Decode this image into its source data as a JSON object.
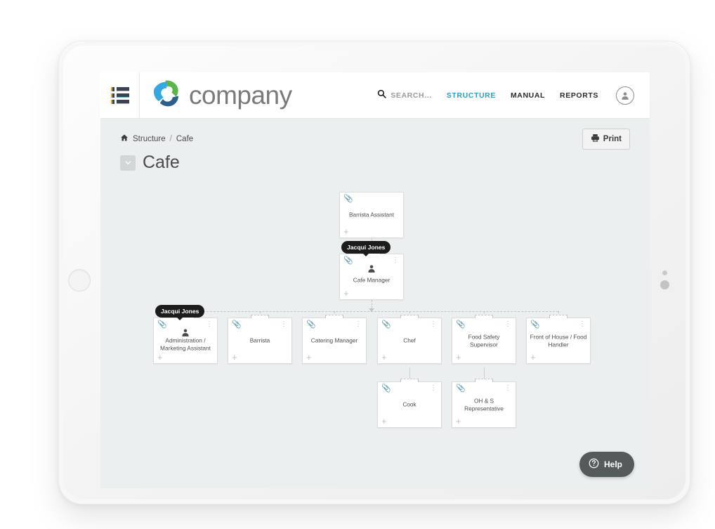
{
  "header": {
    "menu_icon": "list-menu-icon",
    "brand_name": "company",
    "logo_icon": "pinwheel-logo-icon",
    "search": {
      "icon": "search-icon",
      "placeholder": "SEARCH..."
    },
    "nav": [
      {
        "label": "STRUCTURE",
        "active": true
      },
      {
        "label": "MANUAL",
        "active": false
      },
      {
        "label": "REPORTS",
        "active": false
      }
    ],
    "avatar_icon": "user-avatar-icon"
  },
  "breadcrumb": {
    "home_icon": "home-icon",
    "items": [
      "Structure",
      "Cafe"
    ],
    "separator": "/"
  },
  "toolbar": {
    "print_label": "Print",
    "print_icon": "printer-icon"
  },
  "page": {
    "title": "Cafe",
    "collapse_icon": "chevron-down-icon"
  },
  "help": {
    "label": "Help",
    "icon": "question-circle-icon"
  },
  "chart_data": {
    "type": "org-chart",
    "title": "Cafe",
    "node_icons": {
      "attachment": "paperclip-icon",
      "menu": "more-vertical-icon",
      "add": "plus-icon",
      "person": "person-icon"
    },
    "nodes": [
      {
        "id": "barrista-assistant",
        "label": "Barrista Assistant",
        "assignee": null,
        "has_avatar": false,
        "parent": null
      },
      {
        "id": "cafe-manager",
        "label": "Cafe Manager",
        "assignee": "Jacqui Jones",
        "has_avatar": true,
        "parent": "barrista-assistant"
      },
      {
        "id": "administration-marketing-assistant",
        "label": "Administration / Marketing Assistant",
        "assignee": "Jacqui Jones",
        "has_avatar": true,
        "parent": "cafe-manager"
      },
      {
        "id": "barrista",
        "label": "Barrista",
        "assignee": null,
        "has_avatar": false,
        "parent": "cafe-manager"
      },
      {
        "id": "catering-manager",
        "label": "Catering Manager",
        "assignee": null,
        "has_avatar": false,
        "parent": "cafe-manager"
      },
      {
        "id": "chef",
        "label": "Chef",
        "assignee": null,
        "has_avatar": false,
        "parent": "cafe-manager"
      },
      {
        "id": "food-safety-supervisor",
        "label": "Food Safety Supervisor",
        "assignee": null,
        "has_avatar": false,
        "parent": "cafe-manager"
      },
      {
        "id": "front-of-house-food-handler",
        "label": "Front of House / Food Handler",
        "assignee": null,
        "has_avatar": false,
        "parent": "cafe-manager"
      },
      {
        "id": "cook",
        "label": "Cook",
        "assignee": null,
        "has_avatar": false,
        "parent": "chef"
      },
      {
        "id": "oh-s-representative",
        "label": "OH & S Representative",
        "assignee": null,
        "has_avatar": false,
        "parent": "food-safety-supervisor"
      }
    ]
  },
  "colors": {
    "accent": "#2e9fc0",
    "logo_blue": "#35a8e0",
    "logo_green": "#5ab54a",
    "logo_navy": "#2d5f8b",
    "badge_bg": "#1c1c1c",
    "help_bg": "#555b5b",
    "canvas_bg": "#eceff0"
  }
}
